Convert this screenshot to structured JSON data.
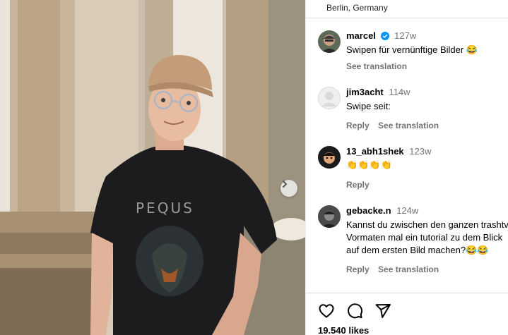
{
  "post": {
    "location": "Berlin, Germany",
    "likes": "19.540 likes"
  },
  "comments": [
    {
      "username": "marcel",
      "verified": true,
      "time": "127w",
      "text": "Swipen für vernünftige Bilder 😂",
      "actions": [
        "See translation"
      ]
    },
    {
      "username": "jim3acht",
      "verified": false,
      "time": "114w",
      "text": "Swipe seit:",
      "actions": [
        "Reply",
        "See translation"
      ]
    },
    {
      "username": "13_abh1shek",
      "verified": false,
      "time": "123w",
      "text": "👏👏👏👏",
      "actions": [
        "Reply"
      ]
    },
    {
      "username": "gebacke.n",
      "verified": false,
      "time": "124w",
      "text": "Kannst du zwischen den ganzen trashtv Vormaten mal ein tutorial zu dem Blick auf dem ersten Bild machen?😂😂",
      "actions": [
        "Reply",
        "See translation"
      ]
    }
  ],
  "icons": {
    "verified": "verified-badge-icon",
    "like": "heart-icon",
    "comment": "comment-icon",
    "share": "share-icon",
    "next": "chevron-right-icon"
  },
  "colors": {
    "verified": "#0095f6",
    "secondary_text": "#737373",
    "divider": "#dbdbdb"
  }
}
